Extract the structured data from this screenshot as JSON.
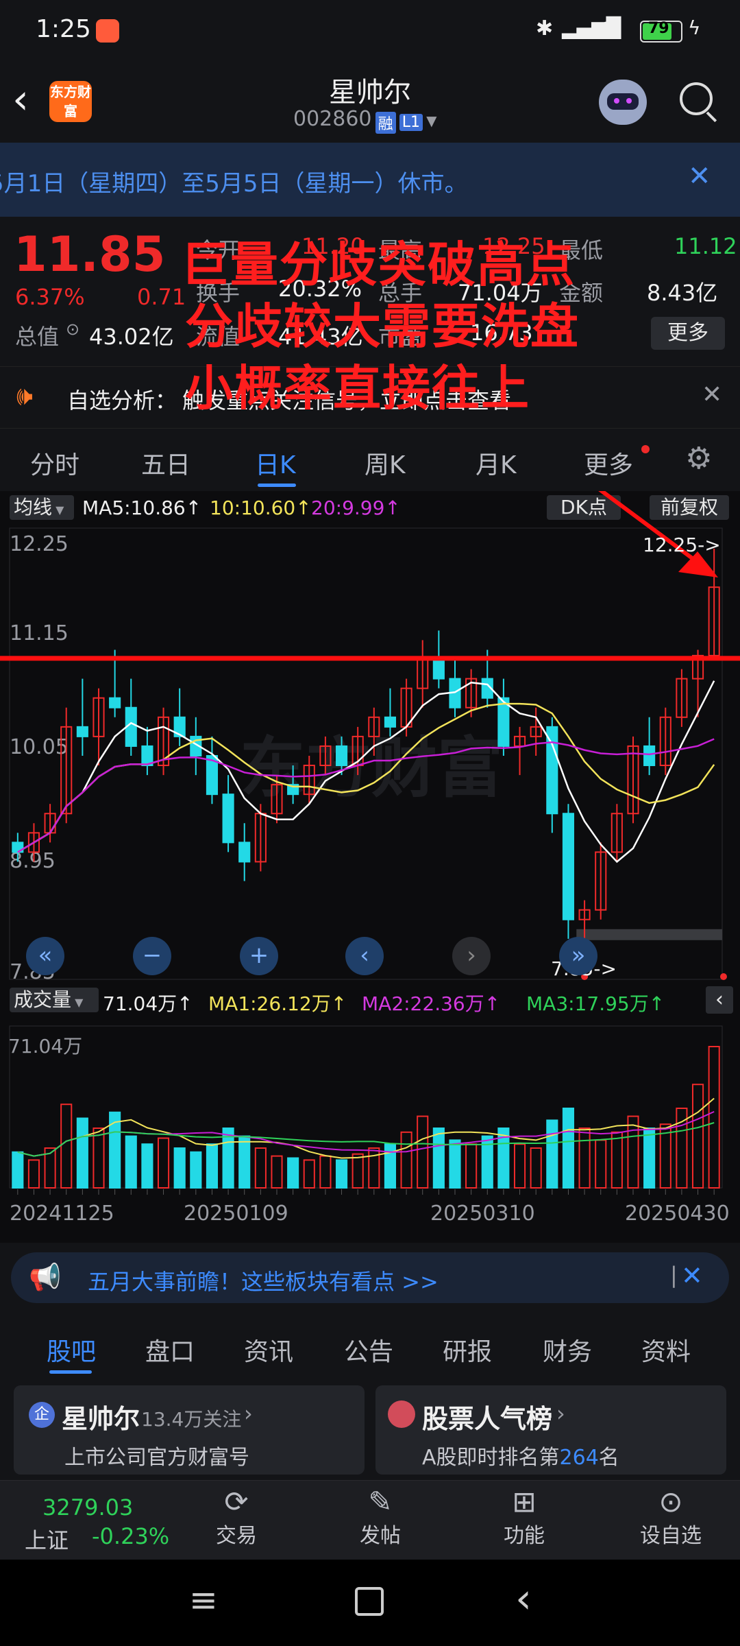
{
  "status_bar": {
    "time": "1:25",
    "battery": "79"
  },
  "header": {
    "logo_text": "东方财富",
    "title": "星帅尔",
    "code": "002860",
    "badge_rong": "融",
    "badge_level": "L1"
  },
  "notice": {
    "text": "5月1日（星期四）至5月5日（星期一）休市。"
  },
  "quote": {
    "price": "11.85",
    "change_pct": "6.37%",
    "change_abs": "0.71",
    "open_label": "今开",
    "open": "11.20",
    "high_label": "最高",
    "high": "12.25",
    "low_label": "最低",
    "low": "11.12",
    "turnover_label": "换手",
    "turnover": "20.32%",
    "volume_label": "总手",
    "volume": "71.04万",
    "amount_label": "金额",
    "amount": "8.43亿",
    "mktcap_label": "总值",
    "mktcap": "43.02亿",
    "float_label": "流值",
    "float": "41.43亿",
    "pe_label": "市盈",
    "pe": "16.73",
    "more_button": "更多"
  },
  "analysis": {
    "label": "自选分析：",
    "text": "触发重点关注信号，立即点击查看"
  },
  "period_tabs": [
    "分时",
    "五日",
    "日K",
    "周K",
    "月K",
    "更多"
  ],
  "active_period": 2,
  "chart_toolbar": {
    "ma_select": "均线",
    "ma5": "MA5:10.86↑",
    "ma10": "10:10.60↑",
    "ma20": "20:9.99↑",
    "dk_button": "DK点",
    "fq_button": "前复权"
  },
  "price_axis": [
    "12.25",
    "11.15",
    "10.05",
    "8.95",
    "7.85"
  ],
  "max_label": "12.25->",
  "min_label": "7.85->",
  "watermark": "东方财富",
  "volume_toolbar": {
    "select": "成交量",
    "vol": "71.04万↑",
    "ma1": "MA1:26.12万↑",
    "ma2": "MA2:22.36万↑",
    "ma3": "MA3:17.95万↑"
  },
  "volume_axis": "71.04万",
  "dates": [
    "20241125",
    "20250109",
    "20250310",
    "20250430"
  ],
  "annotation": [
    "巨量分歧突破高点",
    "分歧较大需要洗盘",
    "小概率直接往上"
  ],
  "banner": {
    "text": "五月大事前瞻！这些板块有看点 >>"
  },
  "bottom_tabs": [
    "股吧",
    "盘口",
    "资讯",
    "公告",
    "研报",
    "财务",
    "资料"
  ],
  "card_left": {
    "badge": "企",
    "title": "星帅尔",
    "follow": "13.4万关注",
    "subtitle": "上市公司官方财富号"
  },
  "card_right": {
    "title": "股票人气榜",
    "subtitle_pre": "A股即时排名第",
    "rank": "264",
    "subtitle_post": "名"
  },
  "index": {
    "value": "3279.03",
    "name": "上证",
    "change": "-0.23%"
  },
  "bottom_actions": [
    "交易",
    "发帖",
    "功能",
    "设自选"
  ],
  "colors": {
    "up": "#f02a2a",
    "down": "#23d9e6",
    "ma5": "#ffffff",
    "ma10": "#f2e35a",
    "ma20": "#c81fd6",
    "accent": "#3d8bff"
  },
  "chart_data": {
    "type": "candlestick",
    "ylim": [
      7.85,
      12.25
    ],
    "candles": [
      [
        9.2,
        9.3,
        9.0,
        9.1
      ],
      [
        9.1,
        9.4,
        9.0,
        9.3
      ],
      [
        9.3,
        9.6,
        9.2,
        9.5
      ],
      [
        9.5,
        10.6,
        9.4,
        10.4
      ],
      [
        10.4,
        10.9,
        10.1,
        10.3
      ],
      [
        10.3,
        10.8,
        10.0,
        10.7
      ],
      [
        10.7,
        11.2,
        10.5,
        10.6
      ],
      [
        10.6,
        10.9,
        10.1,
        10.2
      ],
      [
        10.2,
        10.4,
        9.9,
        10.0
      ],
      [
        10.0,
        10.6,
        9.9,
        10.5
      ],
      [
        10.5,
        10.8,
        10.2,
        10.3
      ],
      [
        10.3,
        10.5,
        9.9,
        10.1
      ],
      [
        10.1,
        10.3,
        9.6,
        9.7
      ],
      [
        9.7,
        9.9,
        9.1,
        9.2
      ],
      [
        9.2,
        9.4,
        8.8,
        9.0
      ],
      [
        9.0,
        9.6,
        8.9,
        9.5
      ],
      [
        9.5,
        9.9,
        9.4,
        9.8
      ],
      [
        9.8,
        10.0,
        9.6,
        9.7
      ],
      [
        9.7,
        10.1,
        9.6,
        10.0
      ],
      [
        10.0,
        10.3,
        9.9,
        10.2
      ],
      [
        10.2,
        10.3,
        9.9,
        10.0
      ],
      [
        10.0,
        10.4,
        9.9,
        10.3
      ],
      [
        10.3,
        10.6,
        10.1,
        10.5
      ],
      [
        10.5,
        10.8,
        10.3,
        10.4
      ],
      [
        10.4,
        10.9,
        10.3,
        10.8
      ],
      [
        10.8,
        11.3,
        10.6,
        11.1
      ],
      [
        11.1,
        11.4,
        10.8,
        10.9
      ],
      [
        10.9,
        11.1,
        10.5,
        10.6
      ],
      [
        10.6,
        11.0,
        10.5,
        10.9
      ],
      [
        10.9,
        11.2,
        10.6,
        10.7
      ],
      [
        10.7,
        10.9,
        10.1,
        10.2
      ],
      [
        10.2,
        10.4,
        9.9,
        10.3
      ],
      [
        10.3,
        10.6,
        10.1,
        10.4
      ],
      [
        10.4,
        10.5,
        9.3,
        9.5
      ],
      [
        9.5,
        9.6,
        8.2,
        8.4
      ],
      [
        8.4,
        8.6,
        7.85,
        8.5
      ],
      [
        8.5,
        9.2,
        8.4,
        9.1
      ],
      [
        9.1,
        9.6,
        9.0,
        9.5
      ],
      [
        9.5,
        10.3,
        9.4,
        10.2
      ],
      [
        10.2,
        10.5,
        9.9,
        10.0
      ],
      [
        10.0,
        10.6,
        9.9,
        10.5
      ],
      [
        10.5,
        11.0,
        10.4,
        10.9
      ],
      [
        10.9,
        11.2,
        10.5,
        11.14
      ],
      [
        11.14,
        12.25,
        11.12,
        11.85
      ]
    ],
    "volume": [
      18,
      14,
      20,
      42,
      35,
      30,
      38,
      26,
      22,
      25,
      20,
      18,
      22,
      30,
      26,
      20,
      16,
      15,
      14,
      16,
      14,
      17,
      20,
      22,
      28,
      36,
      30,
      24,
      22,
      26,
      30,
      22,
      20,
      34,
      40,
      30,
      24,
      28,
      36,
      30,
      32,
      40,
      52,
      71.04
    ]
  }
}
